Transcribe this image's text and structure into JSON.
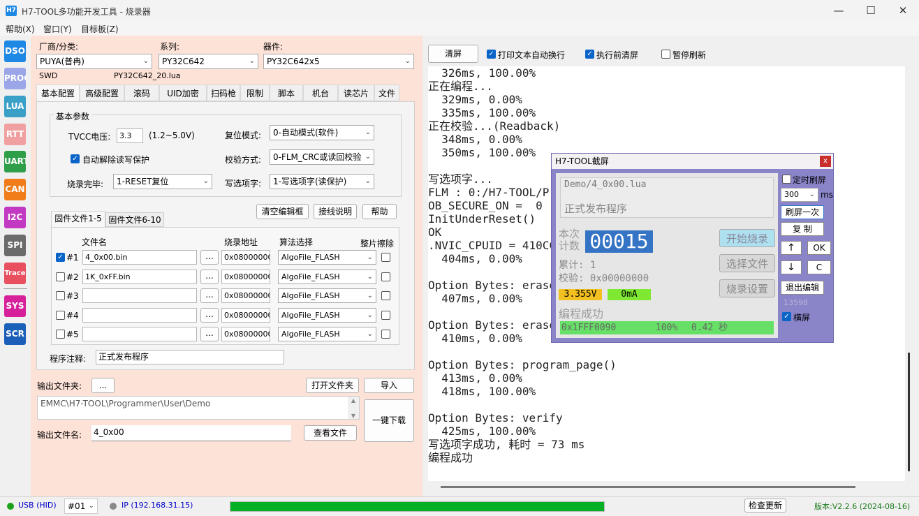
{
  "window": {
    "title": "H7-TOOL多功能开发工具 - 烧录器",
    "icon_text": "H7"
  },
  "menu": [
    "帮助(X)",
    "窗口(Y)",
    "目标板(Z)"
  ],
  "sidebar": [
    {
      "label": "DSO",
      "color": "#1e88e5"
    },
    {
      "label": "PROG",
      "color": "#9aa6e8"
    },
    {
      "label": "LUA",
      "color": "#3aa0c8"
    },
    {
      "label": "RTT",
      "color": "#f0a0a0"
    },
    {
      "label": "UART",
      "color": "#2e9e48"
    },
    {
      "label": "CAN",
      "color": "#f07d1a"
    },
    {
      "label": "I2C",
      "color": "#c23ac2"
    },
    {
      "label": "SPI",
      "color": "#6b6b6b"
    },
    {
      "label": "Trace",
      "color": "#e85060"
    },
    {
      "label": "SYS",
      "color": "#d6219b"
    },
    {
      "label": "SCR",
      "color": "#1c5fb8"
    }
  ],
  "selectors": {
    "vendor_label": "厂商/分类:",
    "vendor_value": "PUYA(普冉)",
    "series_label": "系列:",
    "series_value": "PY32C642",
    "device_label": "器件:",
    "device_value": "PY32C642x5",
    "interface": "SWD",
    "script": "PY32C642_20.lua"
  },
  "tabs": [
    "基本配置",
    "高级配置",
    "滚码",
    "UID加密",
    "扫码枪",
    "限制",
    "脚本",
    "机台",
    "读芯片",
    "文件"
  ],
  "basic": {
    "group_title": "基本参数",
    "tvcc_label": "TVCC电压:",
    "tvcc_value": "3.3",
    "tvcc_range": "(1.2~5.0V)",
    "reset_label": "复位模式:",
    "reset_value": "0-自动模式(软件)",
    "auto_unprotect": "自动解除读写保护",
    "verify_label": "校验方式:",
    "verify_value": "0-FLM_CRC或读回校验",
    "done_label": "烧录完毕:",
    "done_value": "1-RESET复位",
    "option_label": "写选项字:",
    "option_value": "1-写选项字(读保护)"
  },
  "file_buttons": [
    "清空编辑框",
    "接线说明",
    "帮助"
  ],
  "file_tabs": [
    "固件文件1-5",
    "固件文件6-10"
  ],
  "file_headers": {
    "name": "文件名",
    "addr": "烧录地址",
    "algo": "算法选择",
    "erase": "整片擦除"
  },
  "files": [
    {
      "idx": "#1",
      "checked": true,
      "name": "4_0x00.bin",
      "addr": "0x08000000",
      "algo": "AlgoFile_FLASH"
    },
    {
      "idx": "#2",
      "checked": false,
      "name": "1K_0xFF.bin",
      "addr": "0x08000000",
      "algo": "AlgoFile_FLASH"
    },
    {
      "idx": "#3",
      "checked": false,
      "name": "",
      "addr": "0x08000000",
      "algo": "AlgoFile_FLASH"
    },
    {
      "idx": "#4",
      "checked": false,
      "name": "",
      "addr": "0x08000000",
      "algo": "AlgoFile_FLASH"
    },
    {
      "idx": "#5",
      "checked": false,
      "name": "",
      "addr": "0x08000000",
      "algo": "AlgoFile_FLASH"
    }
  ],
  "browse": "...",
  "comment_label": "程序注释:",
  "comment_value": "正式发布程序",
  "output": {
    "folder_label": "输出文件夹:",
    "folder_btn": "...",
    "open_folder": "打开文件夹",
    "import": "导入",
    "path": "EMMC\\H7-TOOL\\Programmer\\User\\Demo",
    "download": "一键下载",
    "name_label": "输出文件名:",
    "name_value": "4_0x00",
    "view_file": "查看文件"
  },
  "console_bar": {
    "clear": "清屏",
    "wrap": "打印文本自动换行",
    "clear_before": "执行前清屏",
    "pause": "暂停刷新"
  },
  "console_lines": [
    "  326ms, 100.00%",
    "正在编程...",
    "  329ms, 0.00%",
    "  335ms, 100.00%",
    "正在校验...(Readback)",
    "  348ms, 0.00%",
    "  350ms, 100.00%",
    "",
    "写选项字...",
    "FLM : 0:/H7-TOOL/Programmer/FLM/PUYA/PY32C642/PY32C642.FLM",
    "OB_SECURE_ON =  0",
    "InitUnderReset()",
    "OK",
    ".NVIC_CPUID = 410CC601",
    "  404ms, 0.00%",
    "",
    "Option Bytes: erase_chip()",
    "  407ms, 0.00%",
    "",
    "Option Bytes: erase_sector()",
    "  410ms, 0.00%",
    "",
    "Option Bytes: program_page()",
    "  413ms, 0.00%",
    "  418ms, 100.00%",
    "",
    "Option Bytes: verify",
    "  425ms, 100.00%",
    "写选项字成功, 耗时 = 73 ms",
    "编程成功"
  ],
  "dialog": {
    "title": "H7-TOOL截屏",
    "close": "x",
    "file": "Demo/4_0x00.lua",
    "note": "正式发布程序",
    "count_label": "本次计数",
    "count_value": "00015",
    "btn_start": "开始烧录",
    "btn_select": "选择文件",
    "btn_settings": "烧录设置",
    "total": "累计: 1",
    "checksum": "校验: 0x00000000",
    "voltage": "3.355V",
    "current": "0mA",
    "status": "编程成功",
    "progress_addr": "0x1FFF0090",
    "progress_pct": "100%",
    "progress_time": "0.42 秒",
    "timer_refresh": "定时刷屏",
    "interval": "300",
    "ms": "ms",
    "refresh_once": "刷屏一次",
    "copy": "复 制",
    "up": "↑",
    "ok": "OK",
    "down": "↓",
    "c": "C",
    "exit_edit": "退出编辑",
    "counter": "13598",
    "landscape": "横屏"
  },
  "status": {
    "usb": "USB (HID)",
    "port": "#01",
    "ip": "IP (192.168.31.15)",
    "progress": 1.0,
    "check_update": "检查更新",
    "version": "版本:V2.2.6 (2024-08-16)"
  }
}
